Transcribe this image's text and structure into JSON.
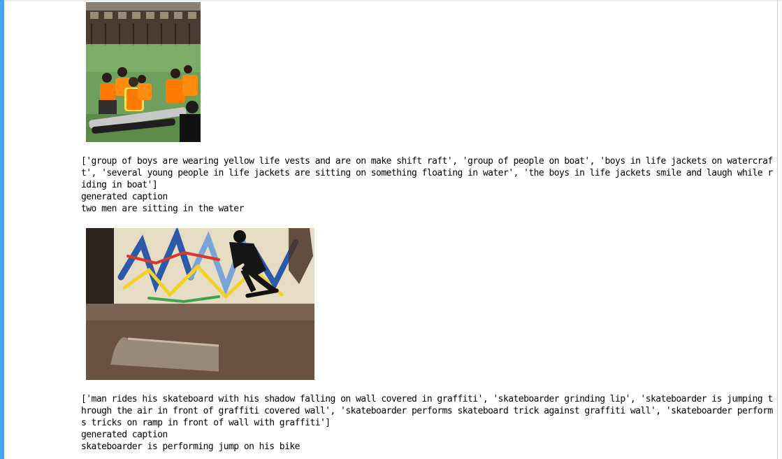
{
  "outputs": [
    {
      "image": {
        "alt": "boys in life vests on a raft",
        "icon": "photo-raft"
      },
      "reference_captions": "['group of boys are wearing yellow life vests and are on make shift raft', 'group of people on boat', 'boys in life jackets on watercraft', 'several young people in life jackets are sitting on something floating in water', 'the boys in life jackets smile and laugh while riding in boat']",
      "generated_label": "generated caption",
      "generated_caption": "two men are sitting in the water"
    },
    {
      "image": {
        "alt": "skateboarder jumping in front of graffiti wall",
        "icon": "photo-skateboard"
      },
      "reference_captions": "['man rides his skateboard with his shadow falling on wall covered in graffiti', 'skateboarder grinding lip', 'skateboarder is jumping through the air in front of graffiti covered wall', 'skateboarder performs skateboard trick against graffiti wall', 'skateboarder performs tricks on ramp in front of wall with graffiti']",
      "generated_label": "generated caption",
      "generated_caption": "skateboarder is performing jump on his bike"
    }
  ],
  "colors": {
    "accent": "#42a5f5",
    "water": "#6e9f5a",
    "vest": "#ff7a00",
    "graffiti_wall": "#d9c9a0",
    "ramp": "#5a4535"
  }
}
